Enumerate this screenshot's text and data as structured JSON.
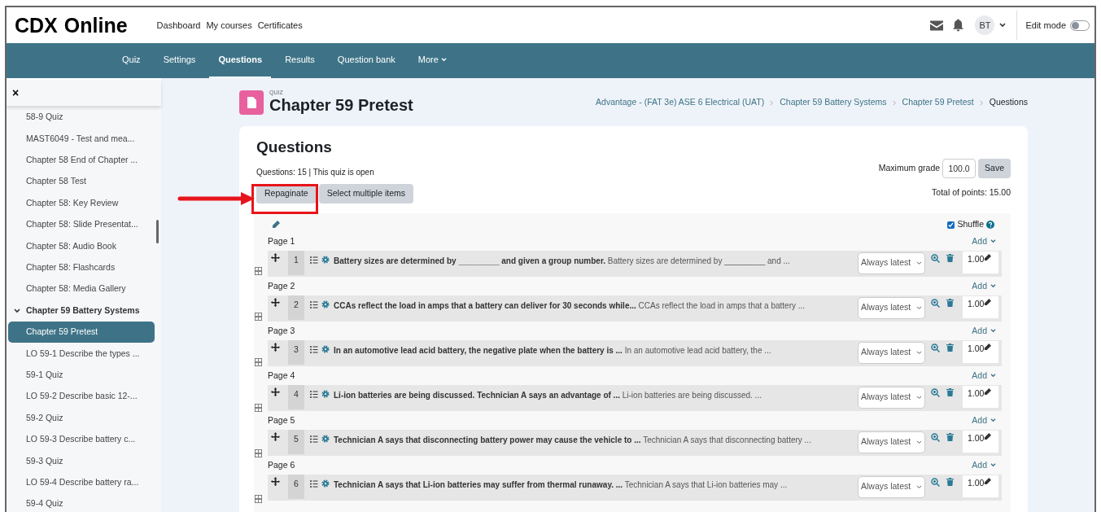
{
  "header": {
    "logo_bold": "CDX",
    "logo_rest": "Online",
    "nav": [
      "Dashboard",
      "My courses",
      "Certificates"
    ],
    "avatar": "BT",
    "edit_mode": {
      "label": "Edit mode",
      "on": false
    }
  },
  "tabs": [
    {
      "label": "Quiz",
      "selected": false
    },
    {
      "label": "Settings",
      "selected": false
    },
    {
      "label": "Questions",
      "selected": true
    },
    {
      "label": "Results",
      "selected": false
    },
    {
      "label": "Question bank",
      "selected": false
    },
    {
      "label": "More",
      "selected": false,
      "dropdown": true
    }
  ],
  "sidebar": {
    "close": "×",
    "items": [
      {
        "kind": "link",
        "label": "58-9 Quiz",
        "selected": false
      },
      {
        "kind": "link",
        "label": "MAST6049 - Test and mea...",
        "selected": false
      },
      {
        "kind": "link",
        "label": "Chapter 58 End of Chapter ...",
        "selected": false
      },
      {
        "kind": "link",
        "label": "Chapter 58 Test",
        "selected": false
      },
      {
        "kind": "link",
        "label": "Chapter 58: Key Review",
        "selected": false
      },
      {
        "kind": "link",
        "label": "Chapter 58: Slide Presentat...",
        "selected": false
      },
      {
        "kind": "link",
        "label": "Chapter 58: Audio Book",
        "selected": false
      },
      {
        "kind": "link",
        "label": "Chapter 58: Flashcards",
        "selected": false
      },
      {
        "kind": "link",
        "label": "Chapter 58: Media Gallery",
        "selected": false
      },
      {
        "kind": "section",
        "label": "Chapter 59 Battery Systems",
        "selected": false,
        "expanded": true
      },
      {
        "kind": "link",
        "label": "Chapter 59 Pretest",
        "selected": true
      },
      {
        "kind": "link",
        "label": "LO 59-1 Describe the types ...",
        "selected": false
      },
      {
        "kind": "link",
        "label": "59-1 Quiz",
        "selected": false
      },
      {
        "kind": "link",
        "label": "LO 59-2 Describe basic 12-...",
        "selected": false
      },
      {
        "kind": "link",
        "label": "59-2 Quiz",
        "selected": false
      },
      {
        "kind": "link",
        "label": "LO 59-3 Describe battery c...",
        "selected": false
      },
      {
        "kind": "link",
        "label": "59-3 Quiz",
        "selected": false
      },
      {
        "kind": "link",
        "label": "LO 59-4 Describe battery ra...",
        "selected": false
      },
      {
        "kind": "link",
        "label": "59-4 Quiz",
        "selected": false
      }
    ]
  },
  "page_header": {
    "kicker": "QUIZ",
    "title": "Chapter 59 Pretest",
    "breadcrumb": [
      "Advantage - (FAT 3e) ASE 6 Electrical (UAT)",
      "Chapter 59 Battery Systems",
      "Chapter 59 Pretest",
      "Questions"
    ]
  },
  "card": {
    "heading": "Questions",
    "info": "Questions: 15 | This quiz is open",
    "buttons": [
      "Repaginate",
      "Select multiple items"
    ],
    "max_grade_label": "Maximum grade",
    "max_grade": "100.0",
    "save": "Save",
    "total": "Total of points: 15.00",
    "shuffle": {
      "label": "Shuffle",
      "checked": true
    }
  },
  "pages": [
    {
      "label": "Page 1",
      "add": "Add",
      "questions": [
        {
          "number": "1",
          "title": "Battery sizes are determined by _________ and given a group number.",
          "preview": "Battery sizes are determined by _________ and ...",
          "version": "Always latest",
          "mark": "1.00"
        }
      ]
    },
    {
      "label": "Page 2",
      "add": "Add",
      "questions": [
        {
          "number": "2",
          "title": "CCAs reflect the load in amps that a battery can deliver for 30 seconds while...",
          "preview": "CCAs reflect the load in amps that a battery ...",
          "version": "Always latest",
          "mark": "1.00"
        }
      ]
    },
    {
      "label": "Page 3",
      "add": "Add",
      "questions": [
        {
          "number": "3",
          "title": "In an automotive lead acid battery, the negative plate when the battery is ...",
          "preview": "In an automotive lead acid battery, the ...",
          "version": "Always latest",
          "mark": "1.00"
        }
      ]
    },
    {
      "label": "Page 4",
      "add": "Add",
      "questions": [
        {
          "number": "4",
          "title": "Li-ion batteries are being discussed. Technician A says an advantage of ...",
          "preview": "Li-ion batteries are being discussed. ...",
          "version": "Always latest",
          "mark": "1.00"
        }
      ]
    },
    {
      "label": "Page 5",
      "add": "Add",
      "questions": [
        {
          "number": "5",
          "title": "Technician A says that disconnecting battery power may cause the vehicle to ...",
          "preview": "Technician A says that disconnecting battery ...",
          "version": "Always latest",
          "mark": "1.00"
        }
      ]
    },
    {
      "label": "Page 6",
      "add": "Add",
      "questions": [
        {
          "number": "6",
          "title": "Technician A says that Li-ion batteries may suffer from thermal runaway. ...",
          "preview": "Technician A says that Li-ion batteries may ...",
          "version": "Always latest",
          "mark": "1.00"
        }
      ]
    }
  ]
}
